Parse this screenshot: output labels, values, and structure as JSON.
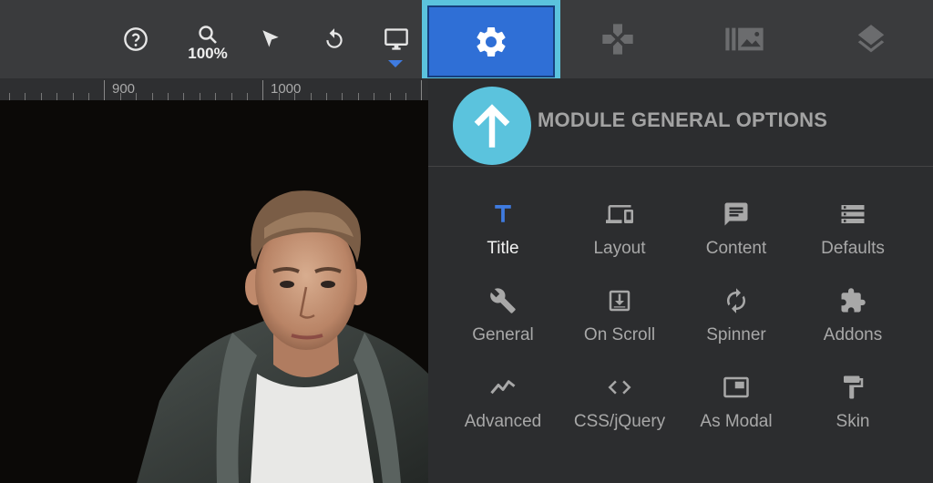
{
  "toolbar": {
    "help_icon": "help-circle-icon",
    "zoom_value": "100%",
    "select_icon": "cursor-arrow-icon",
    "undo_icon": "undo-icon",
    "device_icon": "desktop-monitor-icon"
  },
  "tabs": [
    {
      "icon": "gear-icon",
      "active": true
    },
    {
      "icon": "gamepad-icon",
      "active": false
    },
    {
      "icon": "slides-icon",
      "active": false
    },
    {
      "icon": "layers-icon",
      "active": false
    }
  ],
  "ruler": {
    "labels": [
      "900",
      "1000"
    ]
  },
  "panel": {
    "title": "MODULE GENERAL OPTIONS",
    "options": [
      {
        "label": "Title",
        "icon": "title-t-icon",
        "active": true
      },
      {
        "label": "Layout",
        "icon": "layout-devices-icon",
        "active": false
      },
      {
        "label": "Content",
        "icon": "content-chat-icon",
        "active": false
      },
      {
        "label": "Defaults",
        "icon": "defaults-storage-icon",
        "active": false
      },
      {
        "label": "General",
        "icon": "wrench-icon",
        "active": false
      },
      {
        "label": "On Scroll",
        "icon": "on-scroll-icon",
        "active": false
      },
      {
        "label": "Spinner",
        "icon": "spinner-refresh-icon",
        "active": false
      },
      {
        "label": "Addons",
        "icon": "puzzle-icon",
        "active": false
      },
      {
        "label": "Advanced",
        "icon": "advanced-trend-icon",
        "active": false
      },
      {
        "label": "CSS/jQuery",
        "icon": "code-brackets-icon",
        "active": false
      },
      {
        "label": "As Modal",
        "icon": "modal-window-icon",
        "active": false
      },
      {
        "label": "Skin",
        "icon": "paint-roller-icon",
        "active": false
      }
    ]
  },
  "colors": {
    "accent": "#2f6fd6",
    "highlight": "#5bc3dd"
  }
}
